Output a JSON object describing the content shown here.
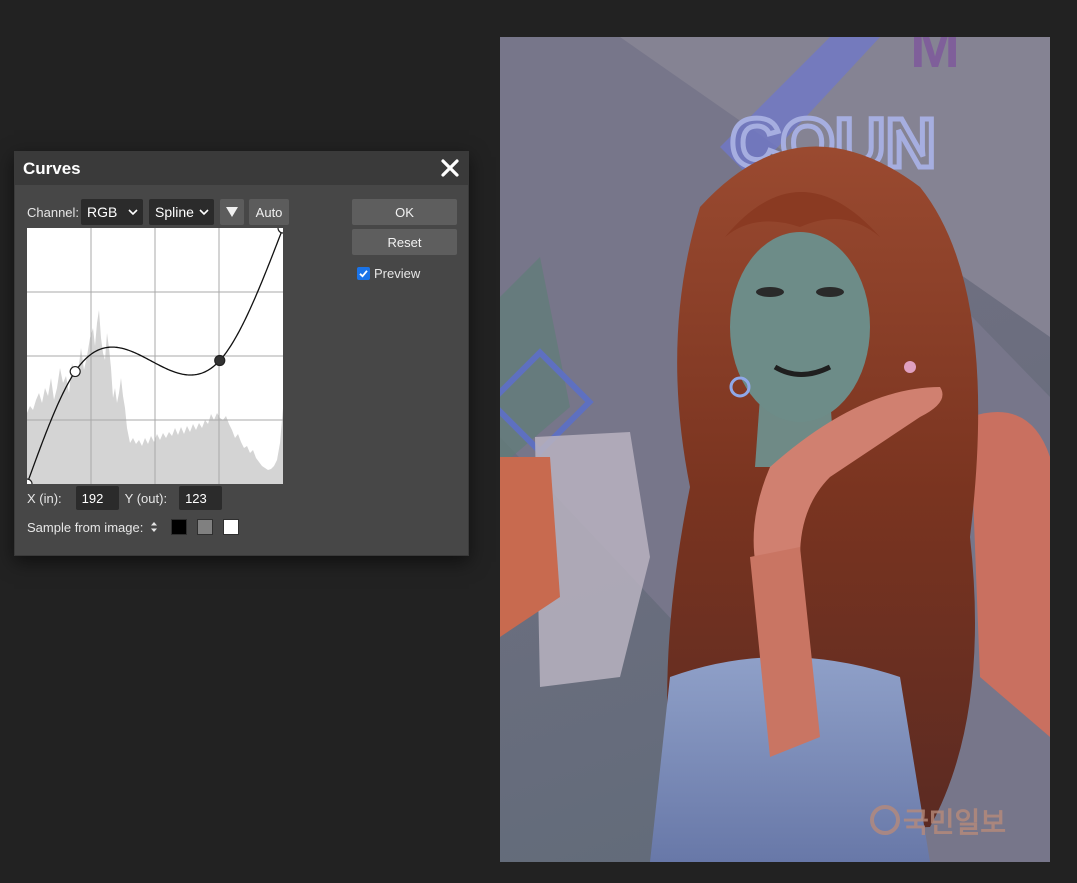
{
  "dialog": {
    "title": "Curves",
    "close_icon": "close-icon",
    "channel_label": "Channel:",
    "channel_value": "RGB",
    "interp_value": "Spline",
    "presets_icon": "triangle-down-icon",
    "auto_label": "Auto",
    "ok_label": "OK",
    "reset_label": "Reset",
    "preview_label": "Preview",
    "preview_checked": true,
    "x_label": "X (in):",
    "x_value": "192",
    "y_label": "Y (out):",
    "y_value": "123",
    "sample_label": "Sample from image:",
    "sample_icon": "up-down-arrows-icon",
    "swatches": [
      "#000000",
      "#808080",
      "#ffffff"
    ]
  },
  "curve": {
    "points": [
      [
        0,
        0
      ],
      [
        48,
        112
      ],
      [
        192,
        123
      ],
      [
        255,
        255
      ]
    ],
    "selected_index": 2,
    "range": [
      0,
      255
    ]
  },
  "canvas": {
    "watermark": "국민일보"
  },
  "colors": {
    "accent": "#1a73e8",
    "dialog_bg": "#474747",
    "workspace_bg": "#222222"
  }
}
